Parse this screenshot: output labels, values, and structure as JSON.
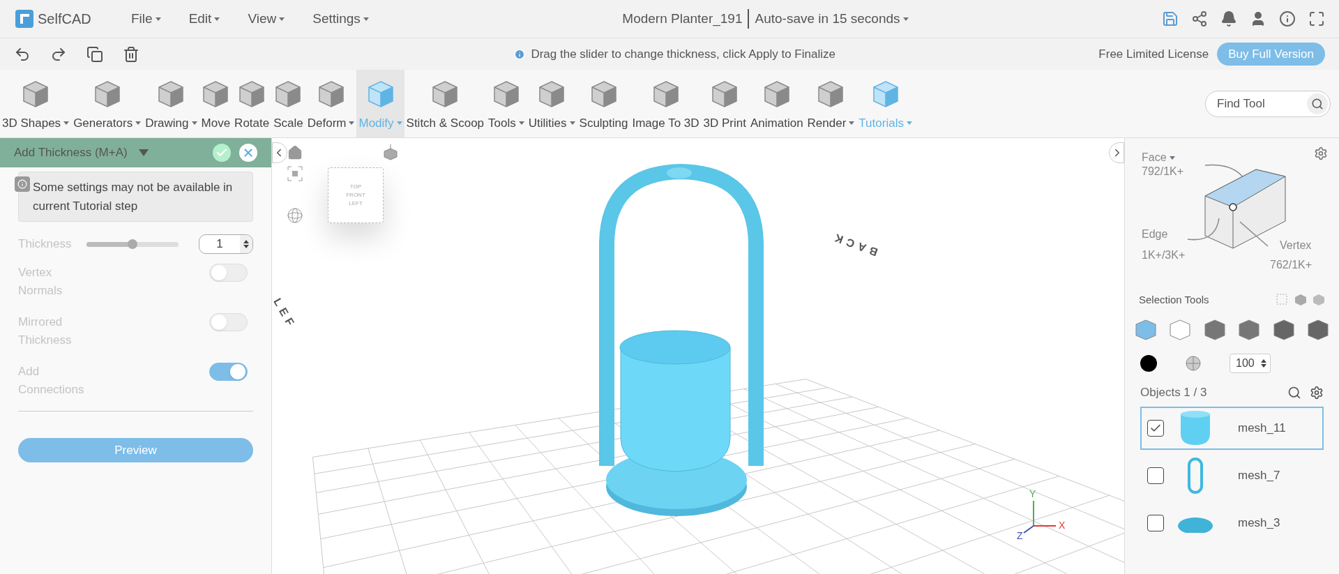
{
  "app": {
    "logo_text": "SelfCAD",
    "menus": [
      {
        "label": "File"
      },
      {
        "label": "Edit"
      },
      {
        "label": "View"
      },
      {
        "label": "Settings"
      }
    ],
    "project_title": "Modern Planter_191",
    "autosave": "Auto-save in 15 seconds"
  },
  "action_bar": {
    "hint": "Drag the slider to change thickness, click Apply to Finalize",
    "license": "Free Limited License",
    "buy_button": "Buy Full Version"
  },
  "toolbar": {
    "tools": [
      {
        "label": "3D Shapes",
        "dropdown": true,
        "selected": false,
        "accent": false
      },
      {
        "label": "Generators",
        "dropdown": true,
        "selected": false,
        "accent": false
      },
      {
        "label": "Drawing",
        "dropdown": true,
        "selected": false,
        "accent": false
      },
      {
        "label": "Move",
        "dropdown": false,
        "selected": false,
        "accent": false
      },
      {
        "label": "Rotate",
        "dropdown": false,
        "selected": false,
        "accent": false
      },
      {
        "label": "Scale",
        "dropdown": false,
        "selected": false,
        "accent": false
      },
      {
        "label": "Deform",
        "dropdown": true,
        "selected": false,
        "accent": false
      },
      {
        "label": "Modify",
        "dropdown": true,
        "selected": true,
        "accent": true
      },
      {
        "label": "Stitch & Scoop",
        "dropdown": false,
        "selected": false,
        "accent": false
      },
      {
        "label": "Tools",
        "dropdown": true,
        "selected": false,
        "accent": false
      },
      {
        "label": "Utilities",
        "dropdown": true,
        "selected": false,
        "accent": false
      },
      {
        "label": "Sculpting",
        "dropdown": false,
        "selected": false,
        "accent": false
      },
      {
        "label": "Image To 3D",
        "dropdown": false,
        "selected": false,
        "accent": false
      },
      {
        "label": "3D Print",
        "dropdown": false,
        "selected": false,
        "accent": false
      },
      {
        "label": "Animation",
        "dropdown": false,
        "selected": false,
        "accent": false
      },
      {
        "label": "Render",
        "dropdown": true,
        "selected": false,
        "accent": false
      },
      {
        "label": "Tutorials",
        "dropdown": true,
        "selected": false,
        "accent": true
      }
    ],
    "find_tool": {
      "placeholder": "Find Tool"
    }
  },
  "tool_panel": {
    "title": "Add Thickness (M+A)",
    "notice": "Some settings may not be available in current Tutorial step",
    "settings": [
      {
        "kind": "slider",
        "label": "Thickness",
        "level": 0.5,
        "value": "1",
        "disabled": true
      },
      {
        "kind": "toggle",
        "label": "Vertex Normals",
        "on": false,
        "disabled": true
      },
      {
        "kind": "toggle",
        "label": "Mirrored Thickness",
        "on": false,
        "disabled": true
      },
      {
        "kind": "toggle",
        "label": "Add Connections",
        "on": true,
        "disabled": true
      }
    ],
    "preview_button": "Preview"
  },
  "viewport": {
    "cube_labels": [
      "TOP",
      "FRONT",
      "LEFT"
    ],
    "floor_labels": [
      "BACK",
      "LEF"
    ],
    "axes": [
      "Y",
      "X",
      "Z"
    ]
  },
  "selection_panel": {
    "face_label": "Face",
    "face_count": "792/1K+",
    "edge_label": "Edge",
    "edge_count": "1K+/3K+",
    "vertex_label": "Vertex",
    "vertex_count": "762/1K+",
    "tools_title": "Selection Tools",
    "opacity": "100",
    "objects_title": "Objects 1 / 3",
    "objects": [
      {
        "name": "mesh_11",
        "checked": true,
        "selected": true,
        "kind": "cup"
      },
      {
        "name": "mesh_7",
        "checked": false,
        "selected": false,
        "kind": "handle"
      },
      {
        "name": "mesh_3",
        "checked": false,
        "selected": false,
        "kind": "base"
      }
    ]
  }
}
